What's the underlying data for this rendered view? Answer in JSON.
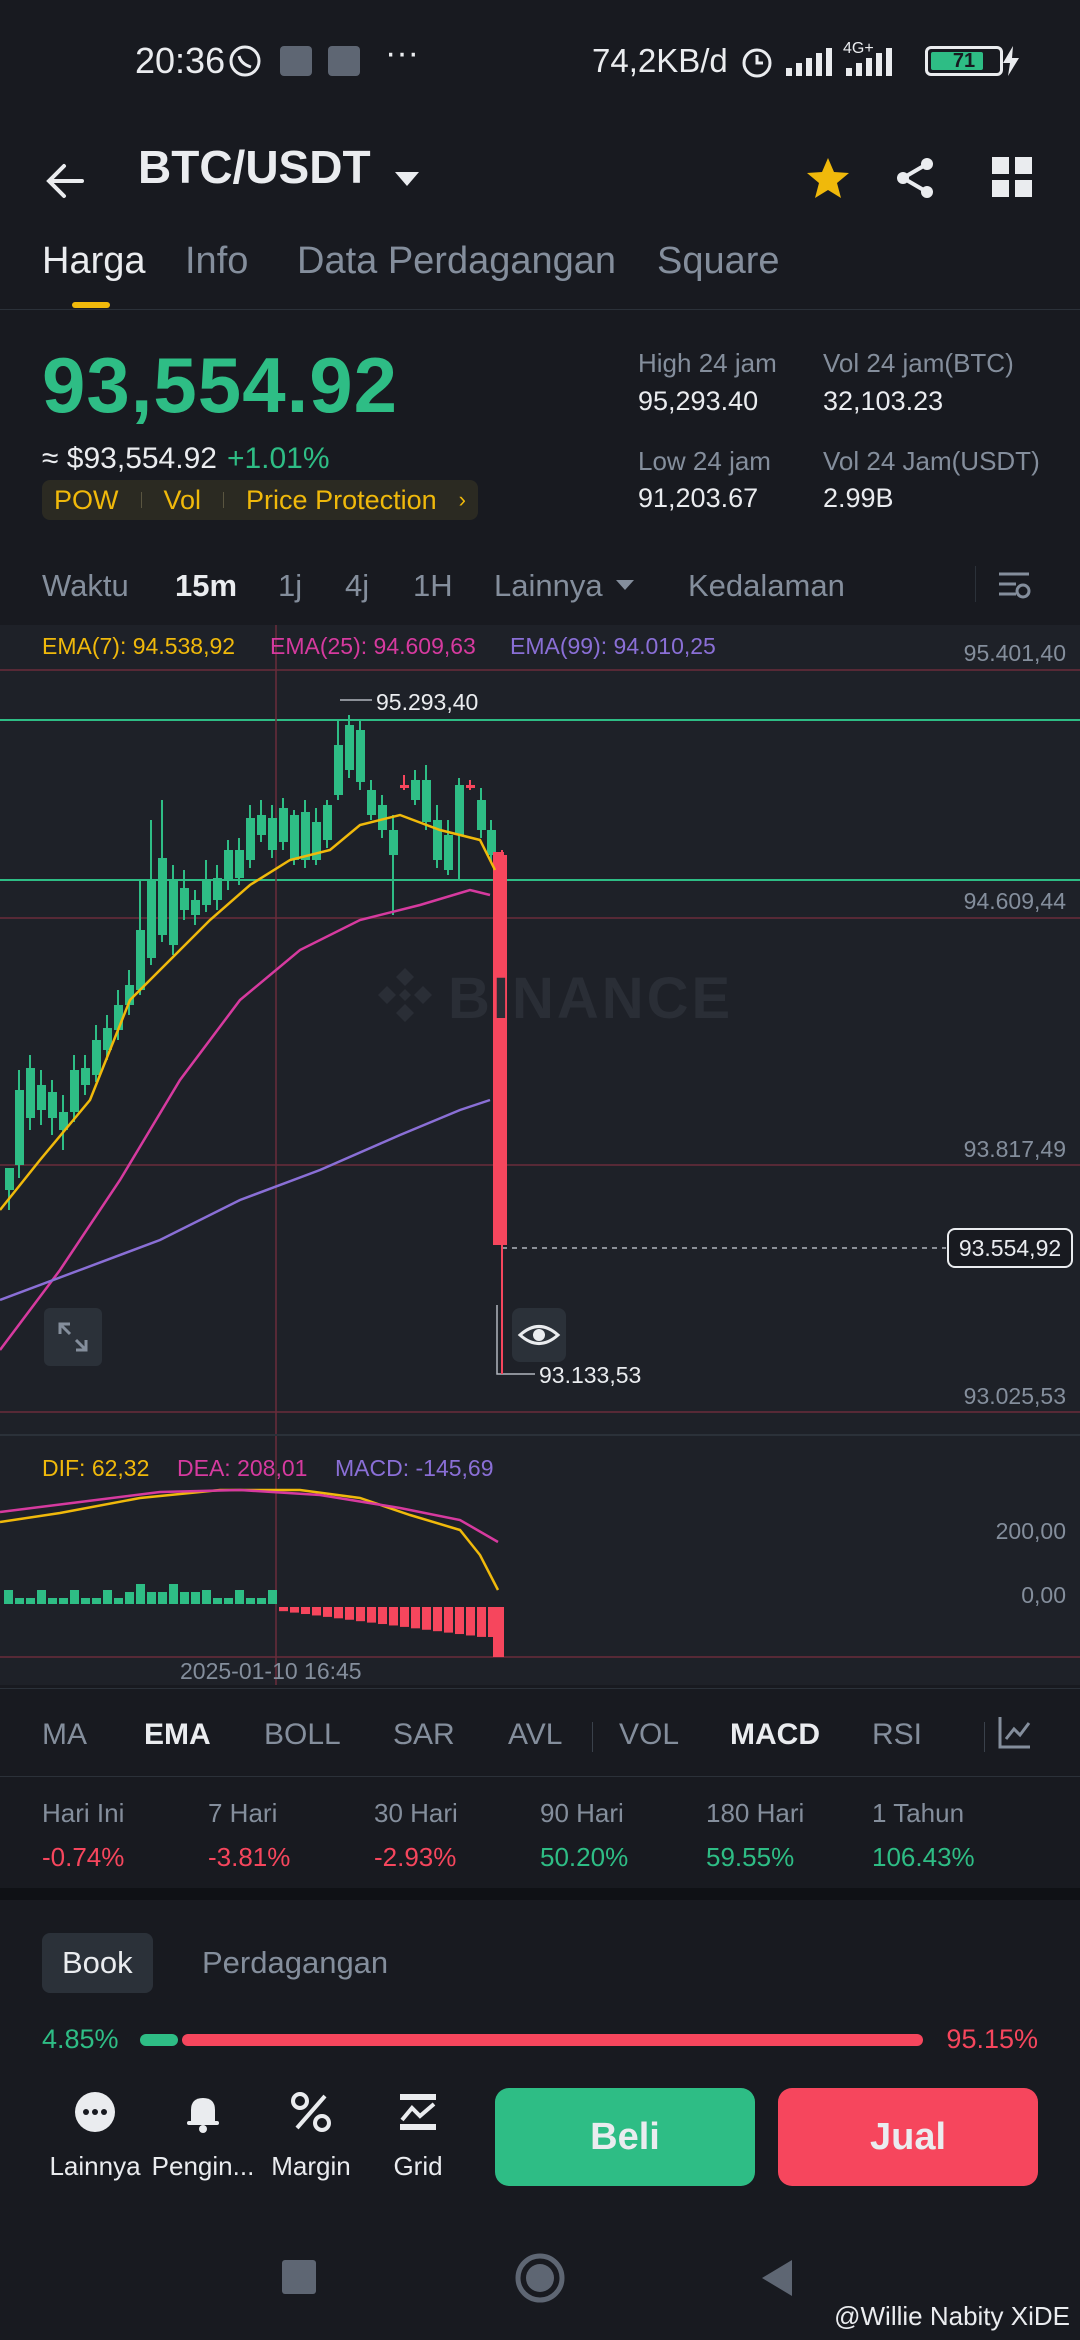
{
  "status_bar": {
    "time": "20:36",
    "network_speed": "74,2KB/d",
    "net_type": "4G+",
    "battery": "71"
  },
  "header": {
    "pair": "BTC/USDT"
  },
  "tabs": [
    "Harga",
    "Info",
    "Data Perdagangan",
    "Square"
  ],
  "price": {
    "last": "93,554.92",
    "fiat": "≈ $93,554.92",
    "change": "+1.01%",
    "chips": [
      "POW",
      "Vol",
      "Price Protection"
    ],
    "stats": {
      "high_label": "High 24 jam",
      "high": "95,293.40",
      "low_label": "Low 24 jam",
      "low": "91,203.67",
      "vol_btc_label": "Vol 24 jam(BTC)",
      "vol_btc": "32,103.23",
      "vol_usdt_label": "Vol 24 Jam(USDT)",
      "vol_usdt": "2.99B"
    }
  },
  "time_bar": {
    "waktu": "Waktu",
    "m15": "15m",
    "h1j": "1j",
    "h4j": "4j",
    "w1h": "1H",
    "lainnya": "Lainnya",
    "kedalaman": "Kedalaman"
  },
  "chart": {
    "ema7": "EMA(7): 94.538,92",
    "ema25": "EMA(25): 94.609,63",
    "ema99": "EMA(99): 94.010,25",
    "y_labels": [
      "95.401,40",
      "94.609,44",
      "93.817,49",
      "93.025,53"
    ],
    "high_marker": "95.293,40",
    "low_marker": "93.133,53",
    "current_price_tag": "93.554,92",
    "watermark": "BINANCE",
    "dif": "DIF: 62,32",
    "dea": "DEA: 208,01",
    "macd": "MACD: -145,69",
    "macd_axis": [
      "200,00",
      "0,00"
    ],
    "timestamp": "2025-01-10 16:45",
    "colors": {
      "up": "#2ebd85",
      "down": "#f6465d",
      "ema7": "#f0b90b",
      "ema25": "#d63a9f",
      "ema99": "#8a6fd6"
    }
  },
  "indicators": [
    "MA",
    "EMA",
    "BOLL",
    "SAR",
    "AVL",
    "VOL",
    "MACD",
    "RSI"
  ],
  "performance": [
    {
      "label": "Hari Ini",
      "value": "-0.74%"
    },
    {
      "label": "7 Hari",
      "value": "-3.81%"
    },
    {
      "label": "30 Hari",
      "value": "-2.93%"
    },
    {
      "label": "90 Hari",
      "value": "50.20%"
    },
    {
      "label": "180 Hari",
      "value": "59.55%"
    },
    {
      "label": "1 Tahun",
      "value": "106.43%"
    }
  ],
  "book": {
    "tab_book": "Book",
    "tab_trades": "Perdagangan",
    "buy_pct": "4.85%",
    "sell_pct": "95.15%",
    "buy_ratio": 0.0485
  },
  "actions": {
    "more": "Lainnya",
    "alert": "Pengin...",
    "margin": "Margin",
    "grid": "Grid",
    "buy": "Beli",
    "sell": "Jual"
  },
  "watermark_credit": "@Willie Nabity XiDE"
}
